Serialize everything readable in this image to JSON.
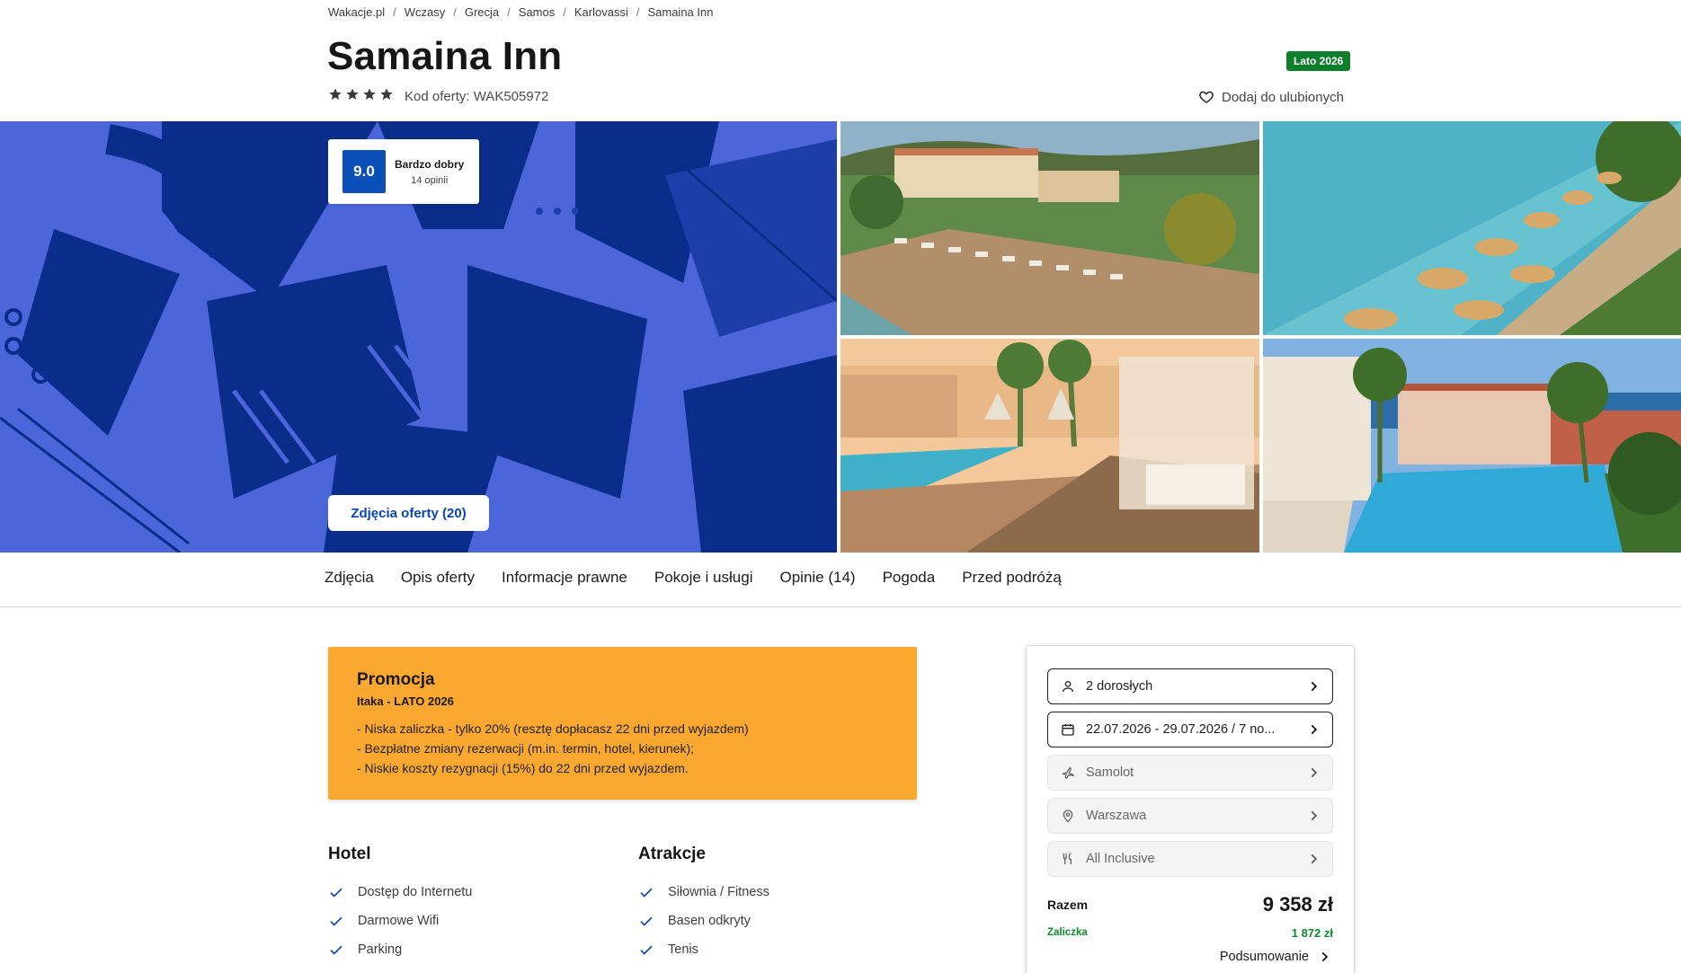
{
  "breadcrumb": [
    "Wakacje.pl",
    "Wczasy",
    "Grecja",
    "Samos",
    "Karlovassi",
    "Samaina Inn"
  ],
  "breadcrumb_separator": "/",
  "hotel": {
    "name": "Samaina Inn",
    "stars": 4,
    "offer_code": "Kod oferty: WAK505972",
    "season_badge": "Lato 2026",
    "favorite_label": "Dodaj do ulubionych"
  },
  "rating": {
    "score": "9.0",
    "label": "Bardzo dobry",
    "count": "14 opinii"
  },
  "gallery": {
    "photos_button": "Zdjęcia oferty (20)"
  },
  "tabs": [
    "Zdjęcia",
    "Opis oferty",
    "Informacje prawne",
    "Pokoje i usługi",
    "Opinie (14)",
    "Pogoda",
    "Przed podróżą"
  ],
  "promo": {
    "title": "Promocja",
    "subtitle": "Itaka - LATO 2026",
    "items": [
      "- Niska zaliczka - tylko 20% (resztę dopłacasz 22 dni przed wyjazdem)",
      "- Bezpłatne zmiany rezerwacji (m.in. termin, hotel, kierunek);",
      "- Niskie koszty rezygnacji (15%) do 22 dni przed wyjazdem."
    ]
  },
  "features": {
    "hotel": {
      "title": "Hotel",
      "items": [
        "Dostęp do Internetu",
        "Darmowe Wifi",
        "Parking"
      ]
    },
    "attractions": {
      "title": "Atrakcje",
      "items": [
        "Siłownia / Fitness",
        "Basen odkryty",
        "Tenis"
      ]
    }
  },
  "booking": {
    "travelers": "2 dorosłych",
    "dates": "22.07.2026 - 29.07.2026 / 7 no...",
    "transport": "Samolot",
    "departure": "Warszawa",
    "board": "All Inclusive",
    "total_label": "Razem",
    "total_value": "9 358 zł",
    "deposit_label": "Zaliczka",
    "deposit_value": "1 872 zł",
    "summary_label": "Podsumowanie"
  },
  "colors": {
    "brand_blue": "#0a45b0",
    "hero_blue": "#4a66d8",
    "promo_orange": "#faa82f",
    "badge_green": "#0d7e2c",
    "deposit_green": "#0d8a2a"
  },
  "icons": {
    "favorite": "heart-icon",
    "star": "star-icon",
    "travelers": "person-icon",
    "dates": "calendar-icon",
    "transport": "plane-icon",
    "departure": "location-pin-icon",
    "board": "utensils-icon",
    "chevron": "chevron-right-icon",
    "check": "check-icon"
  }
}
